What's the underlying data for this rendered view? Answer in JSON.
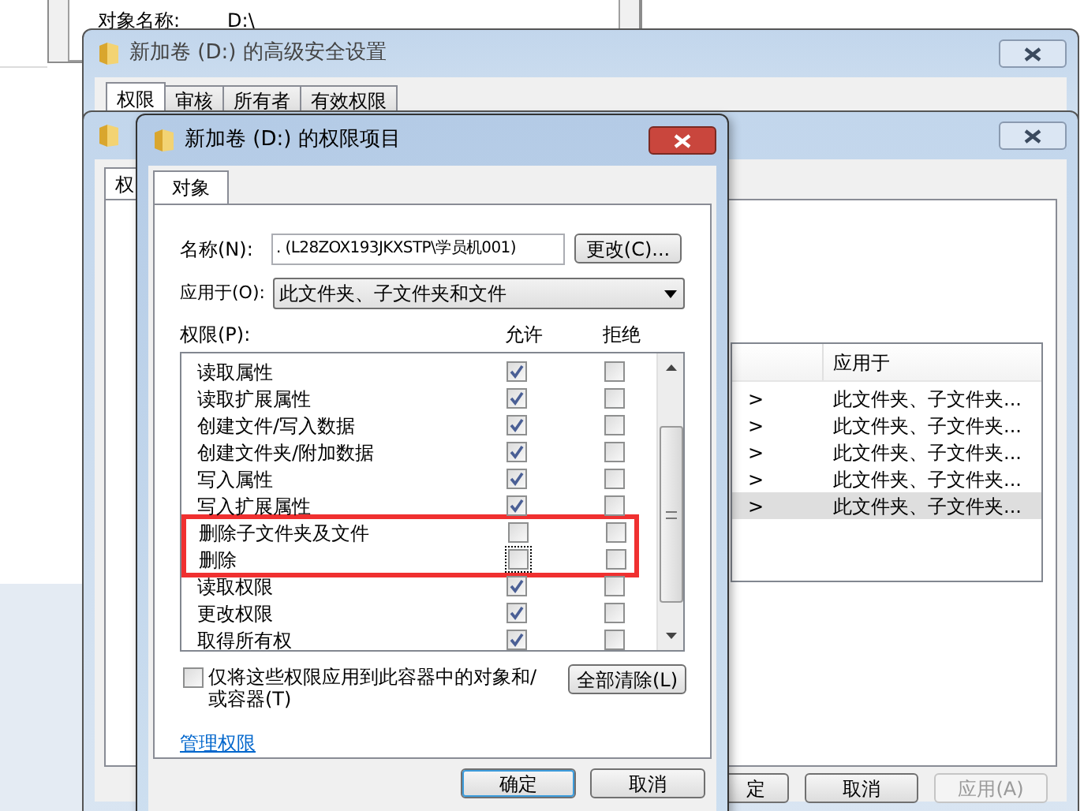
{
  "background_window": {
    "label": "对象名称:",
    "value": "D:\\"
  },
  "advanced_window": {
    "title": "新加卷 (D:) 的高级安全设置",
    "tabs": [
      {
        "label": "权限",
        "selected": true
      },
      {
        "label": "审核",
        "selected": false
      },
      {
        "label": "所有者",
        "selected": false
      },
      {
        "label": "有效权限",
        "selected": false
      }
    ]
  },
  "permissions_window": {
    "tab": {
      "label": "权",
      "selected": true
    },
    "table": {
      "column_header": "应用于",
      "rows": [
        {
          "cell_1": ">",
          "applies_to": "此文件夹、子文件夹...",
          "selected": false
        },
        {
          "cell_1": ">",
          "applies_to": "此文件夹、子文件夹...",
          "selected": false
        },
        {
          "cell_1": ">",
          "applies_to": "此文件夹、子文件夹...",
          "selected": false
        },
        {
          "cell_1": ">",
          "applies_to": "此文件夹、子文件夹...",
          "selected": false
        },
        {
          "cell_1": ">",
          "applies_to": "此文件夹、子文件夹...",
          "selected": true
        }
      ]
    },
    "buttons": [
      {
        "label": "定",
        "disabled": false
      },
      {
        "label": "取消",
        "disabled": false
      },
      {
        "label": "应用(A)",
        "disabled": true
      }
    ]
  },
  "entry_dialog": {
    "title": "新加卷 (D:) 的权限项目",
    "tab": {
      "label": "对象",
      "selected": true
    },
    "name_label": "名称(N):",
    "name_value": ". (L28ZOX193JKXSTP\\学员机001)",
    "change_button": "更改(C)...",
    "apply_label": "应用于(O):",
    "apply_value": "此文件夹、子文件夹和文件",
    "permissions_label": "权限(P):",
    "allow_header": "允许",
    "deny_header": "拒绝",
    "permissions": [
      {
        "name": "读取属性",
        "allow": true,
        "deny": false,
        "focused": false,
        "highlighted": false
      },
      {
        "name": "读取扩展属性",
        "allow": true,
        "deny": false,
        "focused": false,
        "highlighted": false
      },
      {
        "name": "创建文件/写入数据",
        "allow": true,
        "deny": false,
        "focused": false,
        "highlighted": false
      },
      {
        "name": "创建文件夹/附加数据",
        "allow": true,
        "deny": false,
        "focused": false,
        "highlighted": false
      },
      {
        "name": "写入属性",
        "allow": true,
        "deny": false,
        "focused": false,
        "highlighted": false
      },
      {
        "name": "写入扩展属性",
        "allow": true,
        "deny": false,
        "focused": false,
        "highlighted": false
      },
      {
        "name": "删除子文件夹及文件",
        "allow": false,
        "deny": false,
        "focused": false,
        "highlighted": true
      },
      {
        "name": "删除",
        "allow": false,
        "deny": false,
        "focused": true,
        "highlighted": true
      },
      {
        "name": "读取权限",
        "allow": true,
        "deny": false,
        "focused": false,
        "highlighted": false
      },
      {
        "name": "更改权限",
        "allow": true,
        "deny": false,
        "focused": false,
        "highlighted": false
      },
      {
        "name": "取得所有权",
        "allow": true,
        "deny": false,
        "focused": false,
        "highlighted": false
      }
    ],
    "container_only": {
      "label": "仅将这些权限应用到此容器中的对象和/或容器(T)",
      "checked": false
    },
    "clear_all_button": "全部清除(L)",
    "link": "管理权限",
    "buttons": [
      {
        "label": "确定",
        "default": true
      },
      {
        "label": "取消",
        "default": false
      }
    ]
  }
}
